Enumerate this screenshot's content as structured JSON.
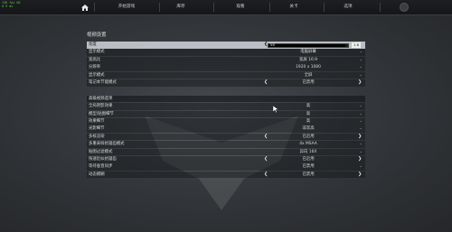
{
  "fps_overlay": [
    "138 fps 60",
    "0.9 ms"
  ],
  "nav": {
    "items": [
      "开始游戏",
      "库存",
      "观看",
      "关卡",
      "选项"
    ]
  },
  "section_title": "视频设置",
  "brightness": {
    "label": "亮度",
    "value_left": "88",
    "value_right": "1.6",
    "fill": 0.97
  },
  "rows": [
    {
      "label": "显示模式",
      "value": "电脑屏幕",
      "type": "dropdown"
    },
    {
      "label": "宽高比",
      "value": "宽屏 16:9",
      "type": "dropdown"
    },
    {
      "label": "分辨率",
      "value": "1920 x 1080",
      "type": "dropdown"
    },
    {
      "label": "显示模式",
      "value": "全屏",
      "type": "dropdown"
    },
    {
      "label": "笔记本节能模式",
      "value": "已禁用",
      "type": "toggle"
    }
  ],
  "advanced": {
    "title": "高级视频选项",
    "rows": [
      {
        "label": "全局阴影效果",
        "value": "高",
        "type": "dropdown"
      },
      {
        "label": "模型/贴图细节",
        "value": "高",
        "type": "dropdown"
      },
      {
        "label": "效果细节",
        "value": "高",
        "type": "dropdown"
      },
      {
        "label": "光影细节",
        "value": "非常高",
        "type": "dropdown"
      },
      {
        "label": "多核渲染",
        "value": "已启用",
        "type": "toggle"
      },
      {
        "label": "多重采样抗锯齿模式",
        "value": "4x MSAA",
        "type": "dropdown"
      },
      {
        "label": "贴图过滤模式",
        "value": "异向 16X",
        "type": "dropdown"
      },
      {
        "label": "快速近似抗锯齿",
        "value": "已启用",
        "type": "toggle"
      },
      {
        "label": "等待垂直同步",
        "value": "已禁用",
        "type": "dropdown"
      },
      {
        "label": "动态模糊",
        "value": "已禁用",
        "type": "toggle"
      }
    ]
  },
  "icons": {
    "home": "home-icon",
    "power": "power-icon",
    "arrow_left": "chevron-left-icon",
    "arrow_right": "chevron-right-icon",
    "dropdown": "chevron-down-icon"
  }
}
